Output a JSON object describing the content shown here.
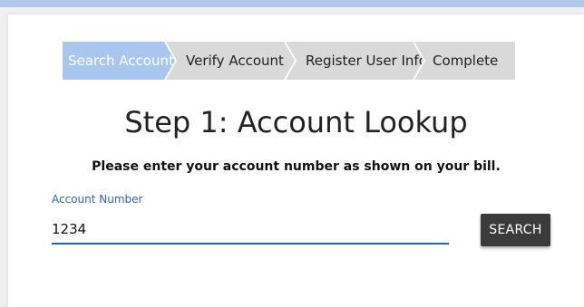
{
  "steps": [
    {
      "label": "Search Account",
      "active": true
    },
    {
      "label": "Verify Account",
      "active": false
    },
    {
      "label": "Register User Info",
      "active": false
    },
    {
      "label": "Complete",
      "active": false
    }
  ],
  "heading": "Step 1: Account Lookup",
  "instructions": "Please enter your account number as shown on your bill.",
  "account_field": {
    "label": "Account Number",
    "value": "1234"
  },
  "search_button": "SEARCH",
  "colors": {
    "accent": "#2a64b7",
    "active_step": "#a9c6ef",
    "inactive_step": "#d9d9d9",
    "button": "#3b3b3b",
    "top_bar": "#b3c9ec"
  }
}
